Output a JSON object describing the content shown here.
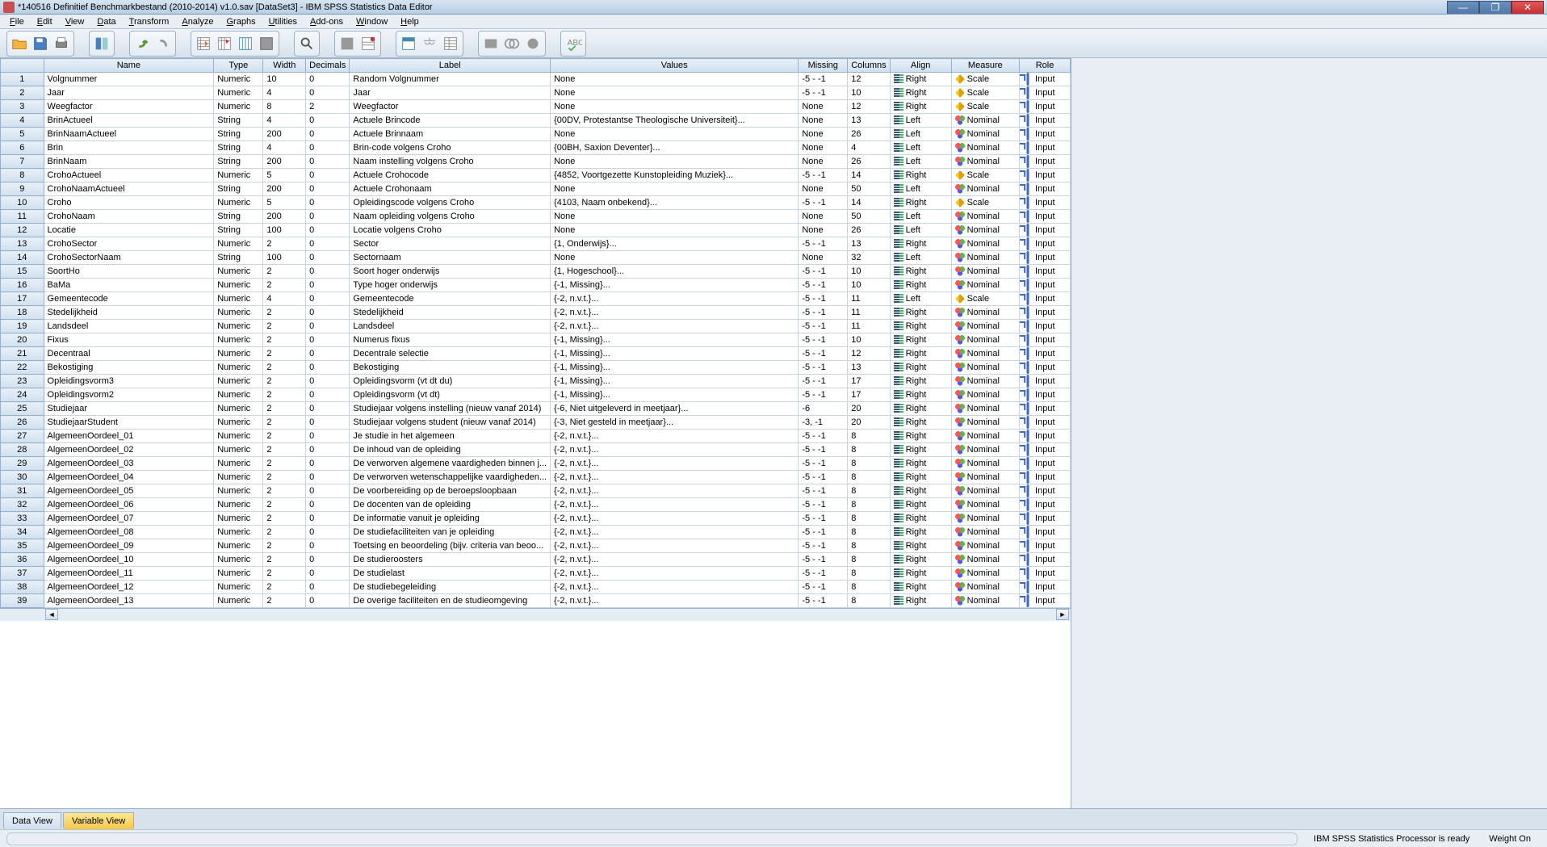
{
  "window": {
    "title": "*140516 Definitief Benchmarkbestand (2010-2014) v1.0.sav [DataSet3] - IBM SPSS Statistics Data Editor"
  },
  "menu": [
    "File",
    "Edit",
    "View",
    "Data",
    "Transform",
    "Analyze",
    "Graphs",
    "Utilities",
    "Add-ons",
    "Window",
    "Help"
  ],
  "columns": [
    "Name",
    "Type",
    "Width",
    "Decimals",
    "Label",
    "Values",
    "Missing",
    "Columns",
    "Align",
    "Measure",
    "Role"
  ],
  "tabs": {
    "data": "Data View",
    "variable": "Variable View"
  },
  "status": {
    "processor": "IBM SPSS Statistics Processor is ready",
    "weight": "Weight On"
  },
  "rows": [
    {
      "n": 1,
      "name": "Volgnummer",
      "type": "Numeric",
      "width": "10",
      "dec": "0",
      "label": "Random Volgnummer",
      "values": "None",
      "missing": "-5 - -1",
      "cols": "12",
      "align": "Right",
      "measure": "Scale",
      "role": "Input"
    },
    {
      "n": 2,
      "name": "Jaar",
      "type": "Numeric",
      "width": "4",
      "dec": "0",
      "label": "Jaar",
      "values": "None",
      "missing": "-5 - -1",
      "cols": "10",
      "align": "Right",
      "measure": "Scale",
      "role": "Input"
    },
    {
      "n": 3,
      "name": "Weegfactor",
      "type": "Numeric",
      "width": "8",
      "dec": "2",
      "label": "Weegfactor",
      "values": "None",
      "missing": "None",
      "cols": "12",
      "align": "Right",
      "measure": "Scale",
      "role": "Input"
    },
    {
      "n": 4,
      "name": "BrinActueel",
      "type": "String",
      "width": "4",
      "dec": "0",
      "label": "Actuele Brincode",
      "values": "{00DV, Protestantse Theologische Universiteit}...",
      "missing": "None",
      "cols": "13",
      "align": "Left",
      "measure": "Nominal",
      "role": "Input"
    },
    {
      "n": 5,
      "name": "BrinNaamActueel",
      "type": "String",
      "width": "200",
      "dec": "0",
      "label": "Actuele Brinnaam",
      "values": "None",
      "missing": "None",
      "cols": "26",
      "align": "Left",
      "measure": "Nominal",
      "role": "Input"
    },
    {
      "n": 6,
      "name": "Brin",
      "type": "String",
      "width": "4",
      "dec": "0",
      "label": "Brin-code volgens Croho",
      "values": "{00BH, Saxion Deventer}...",
      "missing": "None",
      "cols": "4",
      "align": "Left",
      "measure": "Nominal",
      "role": "Input"
    },
    {
      "n": 7,
      "name": "BrinNaam",
      "type": "String",
      "width": "200",
      "dec": "0",
      "label": "Naam instelling volgens Croho",
      "values": "None",
      "missing": "None",
      "cols": "26",
      "align": "Left",
      "measure": "Nominal",
      "role": "Input"
    },
    {
      "n": 8,
      "name": "CrohoActueel",
      "type": "Numeric",
      "width": "5",
      "dec": "0",
      "label": "Actuele Crohocode",
      "values": "{4852, Voortgezette Kunstopleiding Muziek}...",
      "missing": "-5 - -1",
      "cols": "14",
      "align": "Right",
      "measure": "Scale",
      "role": "Input"
    },
    {
      "n": 9,
      "name": "CrohoNaamActueel",
      "type": "String",
      "width": "200",
      "dec": "0",
      "label": "Actuele Crohonaam",
      "values": "None",
      "missing": "None",
      "cols": "50",
      "align": "Left",
      "measure": "Nominal",
      "role": "Input"
    },
    {
      "n": 10,
      "name": "Croho",
      "type": "Numeric",
      "width": "5",
      "dec": "0",
      "label": "Opleidingscode volgens Croho",
      "values": "{4103, Naam onbekend}...",
      "missing": "-5 - -1",
      "cols": "14",
      "align": "Right",
      "measure": "Scale",
      "role": "Input"
    },
    {
      "n": 11,
      "name": "CrohoNaam",
      "type": "String",
      "width": "200",
      "dec": "0",
      "label": "Naam opleiding volgens Croho",
      "values": "None",
      "missing": "None",
      "cols": "50",
      "align": "Left",
      "measure": "Nominal",
      "role": "Input"
    },
    {
      "n": 12,
      "name": "Locatie",
      "type": "String",
      "width": "100",
      "dec": "0",
      "label": "Locatie volgens Croho",
      "values": "None",
      "missing": "None",
      "cols": "26",
      "align": "Left",
      "measure": "Nominal",
      "role": "Input"
    },
    {
      "n": 13,
      "name": "CrohoSector",
      "type": "Numeric",
      "width": "2",
      "dec": "0",
      "label": "Sector",
      "values": "{1, Onderwijs}...",
      "missing": "-5 - -1",
      "cols": "13",
      "align": "Right",
      "measure": "Nominal",
      "role": "Input"
    },
    {
      "n": 14,
      "name": "CrohoSectorNaam",
      "type": "String",
      "width": "100",
      "dec": "0",
      "label": "Sectornaam",
      "values": "None",
      "missing": "None",
      "cols": "32",
      "align": "Left",
      "measure": "Nominal",
      "role": "Input"
    },
    {
      "n": 15,
      "name": "SoortHo",
      "type": "Numeric",
      "width": "2",
      "dec": "0",
      "label": "Soort hoger onderwijs",
      "values": "{1, Hogeschool}...",
      "missing": "-5 - -1",
      "cols": "10",
      "align": "Right",
      "measure": "Nominal",
      "role": "Input"
    },
    {
      "n": 16,
      "name": "BaMa",
      "type": "Numeric",
      "width": "2",
      "dec": "0",
      "label": "Type hoger onderwijs",
      "values": "{-1, Missing}...",
      "missing": "-5 - -1",
      "cols": "10",
      "align": "Right",
      "measure": "Nominal",
      "role": "Input"
    },
    {
      "n": 17,
      "name": "Gemeentecode",
      "type": "Numeric",
      "width": "4",
      "dec": "0",
      "label": "Gemeentecode",
      "values": "{-2, n.v.t.}...",
      "missing": "-5 - -1",
      "cols": "11",
      "align": "Left",
      "measure": "Scale",
      "role": "Input"
    },
    {
      "n": 18,
      "name": "Stedelijkheid",
      "type": "Numeric",
      "width": "2",
      "dec": "0",
      "label": "Stedelijkheid",
      "values": "{-2, n.v.t.}...",
      "missing": "-5 - -1",
      "cols": "11",
      "align": "Right",
      "measure": "Nominal",
      "role": "Input"
    },
    {
      "n": 19,
      "name": "Landsdeel",
      "type": "Numeric",
      "width": "2",
      "dec": "0",
      "label": "Landsdeel",
      "values": "{-2, n.v.t.}...",
      "missing": "-5 - -1",
      "cols": "11",
      "align": "Right",
      "measure": "Nominal",
      "role": "Input"
    },
    {
      "n": 20,
      "name": "Fixus",
      "type": "Numeric",
      "width": "2",
      "dec": "0",
      "label": "Numerus fixus",
      "values": "{-1, Missing}...",
      "missing": "-5 - -1",
      "cols": "10",
      "align": "Right",
      "measure": "Nominal",
      "role": "Input"
    },
    {
      "n": 21,
      "name": "Decentraal",
      "type": "Numeric",
      "width": "2",
      "dec": "0",
      "label": "Decentrale selectie",
      "values": "{-1, Missing}...",
      "missing": "-5 - -1",
      "cols": "12",
      "align": "Right",
      "measure": "Nominal",
      "role": "Input"
    },
    {
      "n": 22,
      "name": "Bekostiging",
      "type": "Numeric",
      "width": "2",
      "dec": "0",
      "label": "Bekostiging",
      "values": "{-1, Missing}...",
      "missing": "-5 - -1",
      "cols": "13",
      "align": "Right",
      "measure": "Nominal",
      "role": "Input"
    },
    {
      "n": 23,
      "name": "Opleidingsvorm3",
      "type": "Numeric",
      "width": "2",
      "dec": "0",
      "label": "Opleidingsvorm (vt dt du)",
      "values": "{-1, Missing}...",
      "missing": "-5 - -1",
      "cols": "17",
      "align": "Right",
      "measure": "Nominal",
      "role": "Input"
    },
    {
      "n": 24,
      "name": "Opleidingsvorm2",
      "type": "Numeric",
      "width": "2",
      "dec": "0",
      "label": "Opleidingsvorm (vt dt)",
      "values": "{-1, Missing}...",
      "missing": "-5 - -1",
      "cols": "17",
      "align": "Right",
      "measure": "Nominal",
      "role": "Input"
    },
    {
      "n": 25,
      "name": "Studiejaar",
      "type": "Numeric",
      "width": "2",
      "dec": "0",
      "label": "Studiejaar volgens instelling (nieuw vanaf 2014)",
      "values": "{-6, Niet uitgeleverd in meetjaar}...",
      "missing": "-6",
      "cols": "20",
      "align": "Right",
      "measure": "Nominal",
      "role": "Input"
    },
    {
      "n": 26,
      "name": "StudiejaarStudent",
      "type": "Numeric",
      "width": "2",
      "dec": "0",
      "label": "Studiejaar volgens student (nieuw vanaf 2014)",
      "values": "{-3, Niet gesteld in meetjaar}...",
      "missing": "-3, -1",
      "cols": "20",
      "align": "Right",
      "measure": "Nominal",
      "role": "Input"
    },
    {
      "n": 27,
      "name": "AlgemeenOordeel_01",
      "type": "Numeric",
      "width": "2",
      "dec": "0",
      "label": "Je studie in het algemeen",
      "values": "{-2, n.v.t.}...",
      "missing": "-5 - -1",
      "cols": "8",
      "align": "Right",
      "measure": "Nominal",
      "role": "Input"
    },
    {
      "n": 28,
      "name": "AlgemeenOordeel_02",
      "type": "Numeric",
      "width": "2",
      "dec": "0",
      "label": "De inhoud van de opleiding",
      "values": "{-2, n.v.t.}...",
      "missing": "-5 - -1",
      "cols": "8",
      "align": "Right",
      "measure": "Nominal",
      "role": "Input"
    },
    {
      "n": 29,
      "name": "AlgemeenOordeel_03",
      "type": "Numeric",
      "width": "2",
      "dec": "0",
      "label": "De verworven algemene vaardigheden binnen j...",
      "values": "{-2, n.v.t.}...",
      "missing": "-5 - -1",
      "cols": "8",
      "align": "Right",
      "measure": "Nominal",
      "role": "Input"
    },
    {
      "n": 30,
      "name": "AlgemeenOordeel_04",
      "type": "Numeric",
      "width": "2",
      "dec": "0",
      "label": "De verworven wetenschappelijke vaardigheden...",
      "values": "{-2, n.v.t.}...",
      "missing": "-5 - -1",
      "cols": "8",
      "align": "Right",
      "measure": "Nominal",
      "role": "Input"
    },
    {
      "n": 31,
      "name": "AlgemeenOordeel_05",
      "type": "Numeric",
      "width": "2",
      "dec": "0",
      "label": "De voorbereiding op de beroepsloopbaan",
      "values": "{-2, n.v.t.}...",
      "missing": "-5 - -1",
      "cols": "8",
      "align": "Right",
      "measure": "Nominal",
      "role": "Input"
    },
    {
      "n": 32,
      "name": "AlgemeenOordeel_06",
      "type": "Numeric",
      "width": "2",
      "dec": "0",
      "label": "De docenten van de opleiding",
      "values": "{-2, n.v.t.}...",
      "missing": "-5 - -1",
      "cols": "8",
      "align": "Right",
      "measure": "Nominal",
      "role": "Input"
    },
    {
      "n": 33,
      "name": "AlgemeenOordeel_07",
      "type": "Numeric",
      "width": "2",
      "dec": "0",
      "label": "De informatie vanuit je opleiding",
      "values": "{-2, n.v.t.}...",
      "missing": "-5 - -1",
      "cols": "8",
      "align": "Right",
      "measure": "Nominal",
      "role": "Input"
    },
    {
      "n": 34,
      "name": "AlgemeenOordeel_08",
      "type": "Numeric",
      "width": "2",
      "dec": "0",
      "label": "De studiefaciliteiten van je opleiding",
      "values": "{-2, n.v.t.}...",
      "missing": "-5 - -1",
      "cols": "8",
      "align": "Right",
      "measure": "Nominal",
      "role": "Input"
    },
    {
      "n": 35,
      "name": "AlgemeenOordeel_09",
      "type": "Numeric",
      "width": "2",
      "dec": "0",
      "label": "Toetsing en beoordeling (bijv. criteria van beoo...",
      "values": "{-2, n.v.t.}...",
      "missing": "-5 - -1",
      "cols": "8",
      "align": "Right",
      "measure": "Nominal",
      "role": "Input"
    },
    {
      "n": 36,
      "name": "AlgemeenOordeel_10",
      "type": "Numeric",
      "width": "2",
      "dec": "0",
      "label": "De studieroosters",
      "values": "{-2, n.v.t.}...",
      "missing": "-5 - -1",
      "cols": "8",
      "align": "Right",
      "measure": "Nominal",
      "role": "Input"
    },
    {
      "n": 37,
      "name": "AlgemeenOordeel_11",
      "type": "Numeric",
      "width": "2",
      "dec": "0",
      "label": "De studielast",
      "values": "{-2, n.v.t.}...",
      "missing": "-5 - -1",
      "cols": "8",
      "align": "Right",
      "measure": "Nominal",
      "role": "Input"
    },
    {
      "n": 38,
      "name": "AlgemeenOordeel_12",
      "type": "Numeric",
      "width": "2",
      "dec": "0",
      "label": "De studiebegeleiding",
      "values": "{-2, n.v.t.}...",
      "missing": "-5 - -1",
      "cols": "8",
      "align": "Right",
      "measure": "Nominal",
      "role": "Input"
    },
    {
      "n": 39,
      "name": "AlgemeenOordeel_13",
      "type": "Numeric",
      "width": "2",
      "dec": "0",
      "label": "De overige faciliteiten en de studieomgeving",
      "values": "{-2, n.v.t.}...",
      "missing": "-5 - -1",
      "cols": "8",
      "align": "Right",
      "measure": "Nominal",
      "role": "Input"
    }
  ]
}
